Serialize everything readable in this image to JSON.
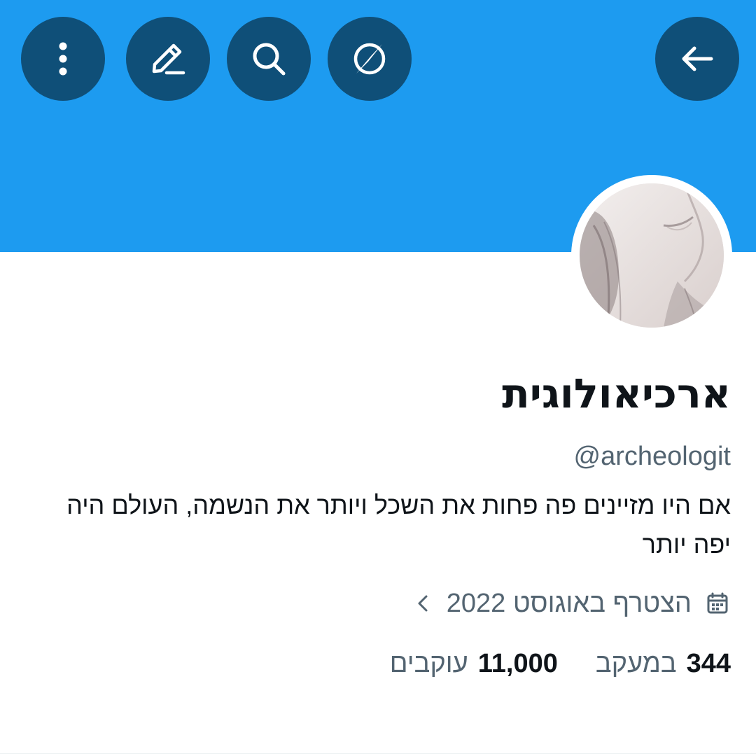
{
  "header": {
    "buttons": {
      "back": "arrow-left-icon",
      "explore": "compass-icon",
      "search": "search-icon",
      "edit": "compose-icon",
      "more": "more-vertical-icon"
    },
    "banner_color": "#1d9bf0",
    "button_color": "#0f4f78"
  },
  "profile": {
    "display_name": "ארכיאולוגית",
    "handle": "@archeologit",
    "bio": "אם היו מזיינים פה פחות את השכל ויותר את הנשמה, העולם היה יפה יותר",
    "joined": "הצטרף באוגוסט 2022",
    "joined_icon": "calendar-icon",
    "following_count": "344",
    "following_label": "במעקב",
    "followers_count": "11,000",
    "followers_label": "עוקבים"
  },
  "colors": {
    "text_primary": "#0f1419",
    "text_secondary": "#536471"
  }
}
